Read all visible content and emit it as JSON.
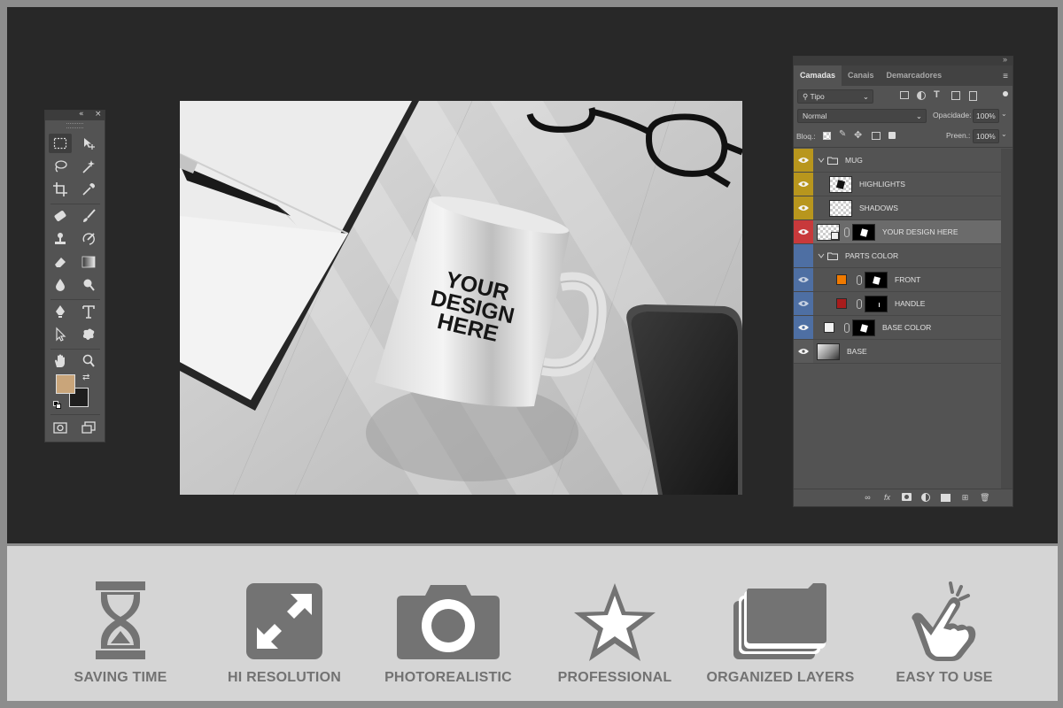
{
  "toolbox": {
    "header_icons": [
      "double-chevron-left-icon",
      "close-icon"
    ]
  },
  "canvas": {
    "mug_text": [
      "YOUR",
      "DESIGN",
      "HERE"
    ]
  },
  "layers_panel": {
    "tabs": [
      {
        "label": "Camadas",
        "active": true
      },
      {
        "label": "Canais",
        "active": false
      },
      {
        "label": "Demarcadores",
        "active": false
      }
    ],
    "filter": {
      "value": "Tipo"
    },
    "blend_mode": "Normal",
    "opacity_label": "Opacidade:",
    "opacity_value": "100%",
    "lock_label": "Bloq.:",
    "fill_label": "Preen.:",
    "fill_value": "100%",
    "layers": [
      {
        "name": "MUG",
        "kind": "group",
        "color": "#b8961d",
        "visible": true,
        "indent": 0
      },
      {
        "name": "HIGHLIGHTS",
        "kind": "layer",
        "color": "#b8961d",
        "visible": true,
        "indent": 1
      },
      {
        "name": "SHADOWS",
        "kind": "layer",
        "color": "#b8961d",
        "visible": true,
        "indent": 1
      },
      {
        "name": "YOUR DESIGN HERE",
        "kind": "smart",
        "color": "#c8393b",
        "visible": true,
        "indent": 0,
        "selected": true
      },
      {
        "name": "PARTS COLOR",
        "kind": "group",
        "color": "#4e6fa3",
        "visible": false,
        "indent": 0
      },
      {
        "name": "FRONT",
        "kind": "fill",
        "color": "#4e6fa3",
        "visible": true,
        "indent": 1,
        "swatch": "#f07a00"
      },
      {
        "name": "HANDLE",
        "kind": "fill",
        "color": "#4e6fa3",
        "visible": true,
        "indent": 1,
        "swatch": "#a81c1c"
      },
      {
        "name": "BASE COLOR",
        "kind": "fill",
        "color": "#4e6fa3",
        "visible": true,
        "indent": 0,
        "swatch": "#f2f2f2"
      },
      {
        "name": "BASE",
        "kind": "image",
        "color": "#5a5a5a",
        "visible": true,
        "indent": 0
      }
    ],
    "footer_icons": [
      "link-icon",
      "fx-icon",
      "mask-icon",
      "adjustment-icon",
      "folder-icon",
      "new-layer-icon",
      "trash-icon"
    ],
    "fx_label": "fx"
  },
  "features": [
    {
      "label": "SAVING TIME",
      "icon": "hourglass-icon"
    },
    {
      "label": "HI RESOLUTION",
      "icon": "expand-icon"
    },
    {
      "label": "PHOTOREALISTIC",
      "icon": "camera-icon"
    },
    {
      "label": "PROFESSIONAL",
      "icon": "star-icon"
    },
    {
      "label": "ORGANIZED LAYERS",
      "icon": "layers-folder-icon"
    },
    {
      "label": "EASY TO USE",
      "icon": "tap-hand-icon"
    }
  ],
  "colors": {
    "workspace": "#282828",
    "panel": "#535353",
    "feature_bg": "#d5d5d5",
    "feature_icon": "#737373",
    "foreground_color": "#c9a57a",
    "background_color": "#1e1e1e"
  }
}
